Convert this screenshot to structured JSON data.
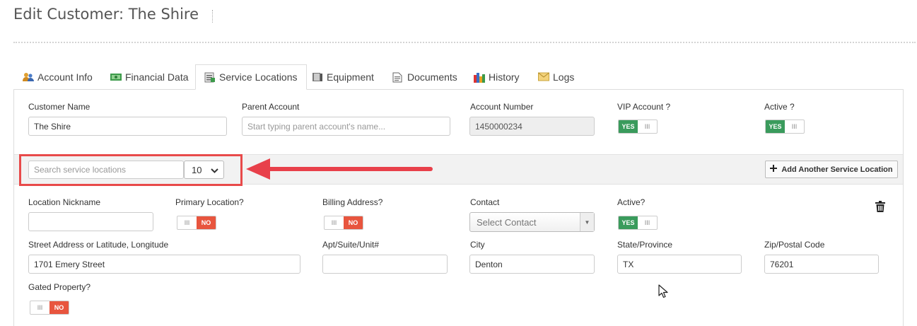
{
  "page": {
    "title": "Edit Customer: The Shire"
  },
  "tabs": [
    {
      "label": "Account Info",
      "icon": "users-icon",
      "active": false
    },
    {
      "label": "Financial Data",
      "icon": "money-icon",
      "active": false
    },
    {
      "label": "Service Locations",
      "icon": "clipboard-icon",
      "active": true
    },
    {
      "label": "Equipment",
      "icon": "book-icon",
      "active": false
    },
    {
      "label": "Documents",
      "icon": "document-icon",
      "active": false
    },
    {
      "label": "History",
      "icon": "bar-chart-icon",
      "active": false
    },
    {
      "label": "Logs",
      "icon": "envelope-icon",
      "active": false
    }
  ],
  "customer": {
    "name_label": "Customer Name",
    "name_value": "The Shire",
    "parent_label": "Parent Account",
    "parent_placeholder": "Start typing parent account's name...",
    "account_number_label": "Account Number",
    "account_number_value": "1450000234",
    "vip_label": "VIP Account ?",
    "vip_state": "YES",
    "active_label": "Active ?",
    "active_state": "YES"
  },
  "toggle_grip": "III",
  "search": {
    "placeholder": "Search service locations",
    "page_size": "10",
    "add_button_label": "Add Another Service Location"
  },
  "location": {
    "nickname_label": "Location Nickname",
    "nickname_value": "",
    "primary_label": "Primary Location?",
    "primary_state": "NO",
    "billing_label": "Billing Address?",
    "billing_state": "NO",
    "contact_label": "Contact",
    "contact_placeholder": "Select Contact",
    "active_label": "Active?",
    "active_state": "YES",
    "street_label": "Street Address or Latitude, Longitude",
    "street_value": "1701 Emery Street",
    "apt_label": "Apt/Suite/Unit#",
    "apt_value": "",
    "city_label": "City",
    "city_value": "Denton",
    "state_label": "State/Province",
    "state_value": "TX",
    "zip_label": "Zip/Postal Code",
    "zip_value": "76201",
    "gated_label": "Gated Property?",
    "gated_state": "NO"
  },
  "colors": {
    "yes": "#3a9b5c",
    "no": "#e8553e",
    "annotation": "#e8404a"
  }
}
